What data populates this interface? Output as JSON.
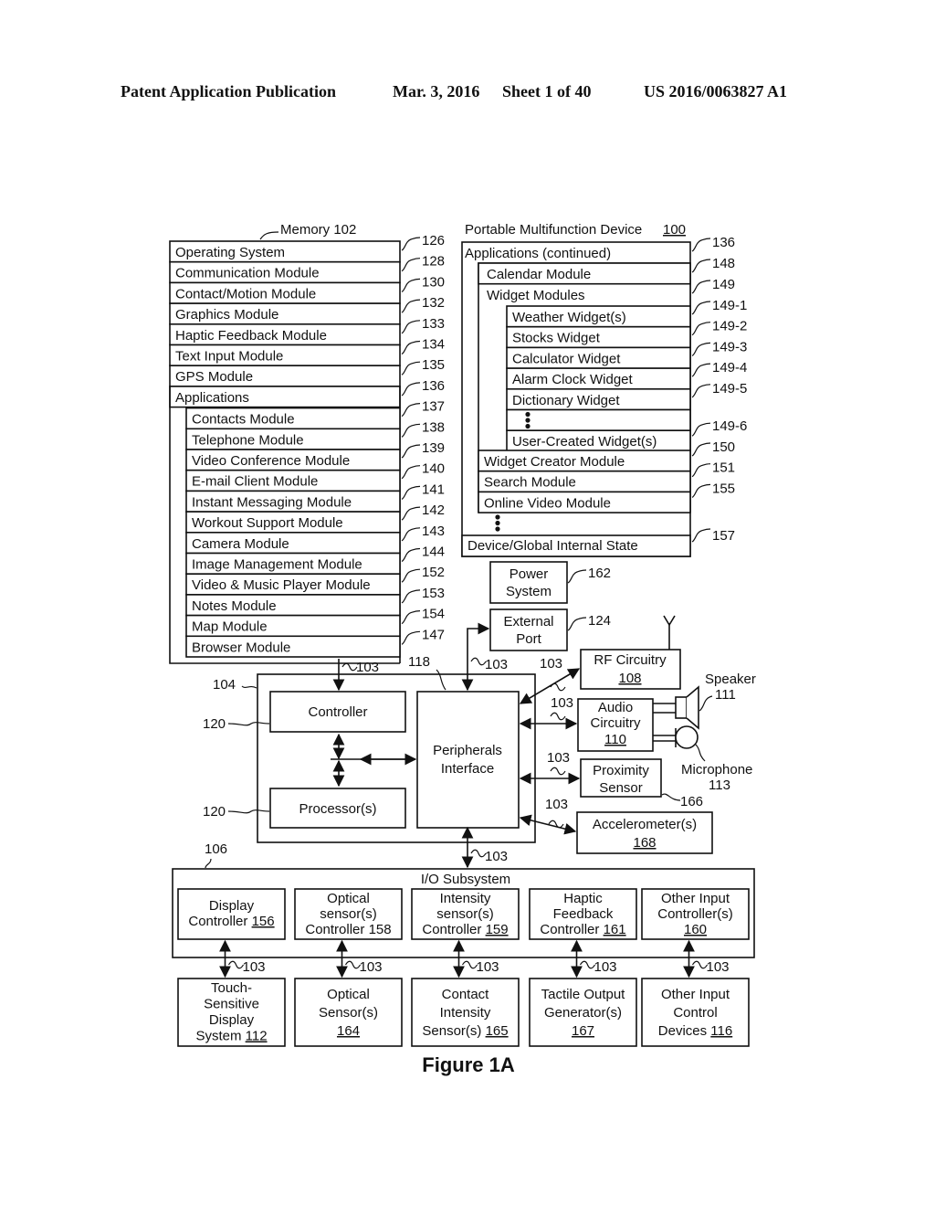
{
  "header": {
    "publication": "Patent Application Publication",
    "date": "Mar. 3, 2016",
    "sheet": "Sheet 1 of 40",
    "number": "US 2016/0063827 A1"
  },
  "figure_label": "Figure 1A",
  "memory": {
    "title": "Memory 102",
    "rows": [
      {
        "label": "Operating System",
        "ref": "126"
      },
      {
        "label": "Communication Module",
        "ref": "128"
      },
      {
        "label": "Contact/Motion Module",
        "ref": "130"
      },
      {
        "label": "Graphics Module",
        "ref": "132"
      },
      {
        "label": "Haptic Feedback Module",
        "ref": "133"
      },
      {
        "label": "Text Input Module",
        "ref": "134"
      },
      {
        "label": "GPS Module",
        "ref": "135"
      },
      {
        "label": "Applications",
        "ref": "136"
      }
    ],
    "applications": [
      {
        "label": "Contacts Module",
        "ref": "137"
      },
      {
        "label": "Telephone Module",
        "ref": "138"
      },
      {
        "label": "Video Conference Module",
        "ref": "139"
      },
      {
        "label": "E-mail Client Module",
        "ref": "140"
      },
      {
        "label": "Instant Messaging Module",
        "ref": "141"
      },
      {
        "label": "Workout Support Module",
        "ref": "142"
      },
      {
        "label": "Camera Module",
        "ref": "143"
      },
      {
        "label": "Image Management Module",
        "ref": "144"
      },
      {
        "label": "Video & Music Player Module",
        "ref": "152"
      },
      {
        "label": "Notes Module",
        "ref": "153"
      },
      {
        "label": "Map Module",
        "ref": "154"
      },
      {
        "label": "Browser Module",
        "ref": "147"
      }
    ]
  },
  "device": {
    "title": "Portable Multifunction Device",
    "title_ref": "100",
    "apps_continued": {
      "label": "Applications (continued)",
      "ref": "136"
    },
    "calendar": {
      "label": "Calendar Module",
      "ref": "148"
    },
    "widget_modules": {
      "label": "Widget Modules",
      "ref": "149"
    },
    "widgets": [
      {
        "label": "Weather Widget(s)",
        "ref": "149-1"
      },
      {
        "label": "Stocks Widget",
        "ref": "149-2"
      },
      {
        "label": "Calculator Widget",
        "ref": "149-3"
      },
      {
        "label": "Alarm Clock Widget",
        "ref": "149-4"
      },
      {
        "label": "Dictionary Widget",
        "ref": "149-5"
      },
      {
        "label": "User-Created Widget(s)",
        "ref": "149-6"
      }
    ],
    "more_modules": [
      {
        "label": "Widget Creator Module",
        "ref": "150"
      },
      {
        "label": "Search Module",
        "ref": "151"
      },
      {
        "label": "Online Video Module",
        "ref": "155"
      }
    ],
    "state": {
      "label": "Device/Global Internal State",
      "ref": "157"
    }
  },
  "power": {
    "line1": "Power",
    "line2": "System",
    "ref": "162"
  },
  "external_port": {
    "line1": "External",
    "line2": "Port",
    "ref": "124"
  },
  "bus_ref": "103",
  "chip": {
    "ref": "104",
    "controller": {
      "label": "Controller",
      "ref": "120"
    },
    "processor": {
      "label": "Processor(s)",
      "ref": "120"
    },
    "peripherals": {
      "line1": "Peripherals",
      "line2": "Interface",
      "ref": "118"
    }
  },
  "rf": {
    "line1": "RF Circuitry",
    "num": "108"
  },
  "audio": {
    "line1": "Audio",
    "line2": "Circuitry",
    "num": "110"
  },
  "speaker": {
    "label": "Speaker",
    "ref": "111"
  },
  "microphone": {
    "label": "Microphone",
    "ref": "113"
  },
  "proximity": {
    "line1": "Proximity",
    "line2": "Sensor",
    "ref": "166"
  },
  "accelerometer": {
    "line1": "Accelerometer(s)",
    "num": "168"
  },
  "io": {
    "title": "I/O Subsystem",
    "ref": "106",
    "controllers": [
      {
        "lines": [
          "Display",
          "Controller"
        ],
        "num": "156",
        "underline": true
      },
      {
        "lines": [
          "Optical",
          "sensor(s)",
          "Controller"
        ],
        "num": "158",
        "underline": false
      },
      {
        "lines": [
          "Intensity",
          "sensor(s)",
          "Controller"
        ],
        "num": "159",
        "underline": true
      },
      {
        "lines": [
          "Haptic",
          "Feedback",
          "Controller"
        ],
        "num": "161",
        "underline": true
      },
      {
        "lines": [
          "Other Input",
          "Controller(s)"
        ],
        "num": "160",
        "underline": true
      }
    ],
    "devices": [
      {
        "lines": [
          "Touch-",
          "Sensitive",
          "Display",
          "System"
        ],
        "num": "112"
      },
      {
        "lines": [
          "Optical",
          "Sensor(s)"
        ],
        "num": "164"
      },
      {
        "lines": [
          "Contact",
          "Intensity",
          "Sensor(s)"
        ],
        "num": "165"
      },
      {
        "lines": [
          "Tactile Output",
          "Generator(s)"
        ],
        "num": "167"
      },
      {
        "lines": [
          "Other Input",
          "Control",
          "Devices"
        ],
        "num": "116"
      }
    ]
  }
}
